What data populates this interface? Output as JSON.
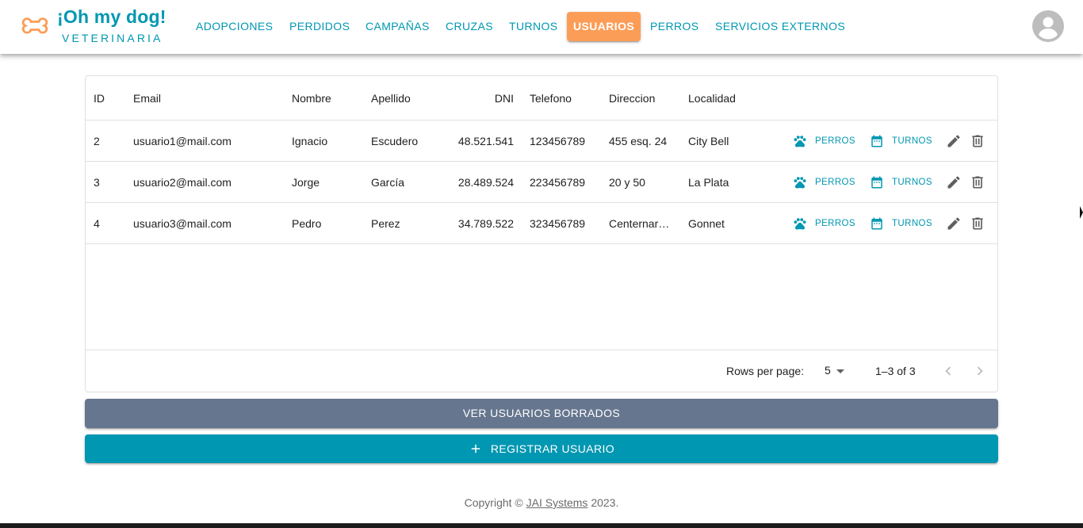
{
  "brand": {
    "title": "¡Oh my dog!",
    "subtitle": "VETERINARIA",
    "logo_icon": "bone-icon",
    "color": "#0097b2",
    "logo_color": "#fc9d57"
  },
  "nav": {
    "items": [
      {
        "label": "ADOPCIONES",
        "active": false
      },
      {
        "label": "PERDIDOS",
        "active": false
      },
      {
        "label": "CAMPAÑAS",
        "active": false
      },
      {
        "label": "CRUZAS",
        "active": false
      },
      {
        "label": "TURNOS",
        "active": false
      },
      {
        "label": "USUARIOS",
        "active": true
      },
      {
        "label": "PERROS",
        "active": false
      },
      {
        "label": "SERVICIOS EXTERNOS",
        "active": false
      }
    ],
    "active_color": "#fc9d57",
    "avatar_icon": "account-circle-icon"
  },
  "table": {
    "columns": [
      "ID",
      "Email",
      "Nombre",
      "Apellido",
      "DNI",
      "Telefono",
      "Direccion",
      "Localidad"
    ],
    "rows": [
      {
        "id": "2",
        "email": "usuario1@mail.com",
        "nombre": "Ignacio",
        "apellido": "Escudero",
        "dni": "48.521.541",
        "telefono": "123456789",
        "direccion": "455 esq. 24",
        "localidad": "City Bell"
      },
      {
        "id": "3",
        "email": "usuario2@mail.com",
        "nombre": "Jorge",
        "apellido": "García",
        "dni": "28.489.524",
        "telefono": "223456789",
        "direccion": "20 y 50",
        "localidad": "La Plata"
      },
      {
        "id": "4",
        "email": "usuario3@mail.com",
        "nombre": "Pedro",
        "apellido": "Perez",
        "dni": "34.789.522",
        "telefono": "323456789",
        "direccion": "Centernar…",
        "localidad": "Gonnet"
      }
    ],
    "row_actions": {
      "dogs_label": "PERROS",
      "dogs_icon": "paw-icon",
      "appointments_label": "TURNOS",
      "appointments_icon": "calendar-icon",
      "edit_icon": "pencil-icon",
      "delete_icon": "delete-icon"
    },
    "pagination": {
      "rows_per_page_label": "Rows per page:",
      "rows_per_page": "5",
      "range": "1–3 of 3",
      "prev_icon": "chevron-left-icon",
      "next_icon": "chevron-right-icon"
    }
  },
  "actions": {
    "view_deleted": "VER USUARIOS BORRADOS",
    "view_deleted_color": "#66768f",
    "register": "REGISTRAR USUARIO",
    "register_icon": "plus-icon",
    "register_color": "#0097b2"
  },
  "footer": {
    "prefix": "Copyright © ",
    "company": "JAI Systems",
    "suffix": " 2023."
  }
}
